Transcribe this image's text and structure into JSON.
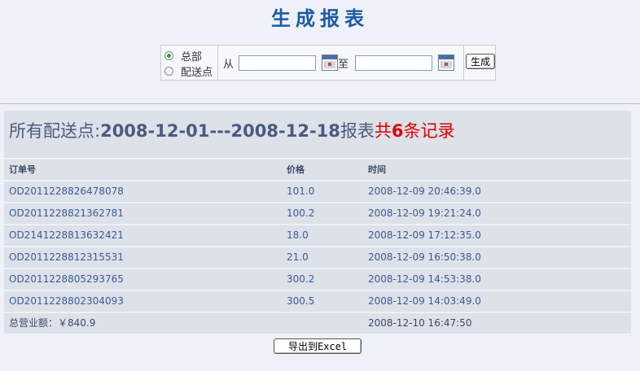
{
  "page": {
    "title": "生成报表"
  },
  "form": {
    "scope_options": [
      {
        "label": "总部",
        "selected": true
      },
      {
        "label": "配送点",
        "selected": false
      }
    ],
    "from_label": "从",
    "to_label": "至",
    "from_value": "",
    "to_value": "",
    "generate_label": "生成"
  },
  "report": {
    "heading_prefix": "所有配送点:",
    "heading_range": "2008-12-01---2008-12-18",
    "heading_suffix": "报表",
    "heading_count_prefix": "共",
    "heading_count": "6",
    "heading_count_suffix": "条记录",
    "columns": [
      "订单号",
      "价格",
      "时间"
    ],
    "rows": [
      {
        "order": "OD2011228826478078",
        "price": "101.0",
        "time": "2008-12-09 20:46:39.0"
      },
      {
        "order": "OD2011228821362781",
        "price": "100.2",
        "time": "2008-12-09 19:21:24.0"
      },
      {
        "order": "OD2141228813632421",
        "price": "18.0",
        "time": "2008-12-09 17:12:35.0"
      },
      {
        "order": "OD2011228812315531",
        "price": "21.0",
        "time": "2008-12-09 16:50:38.0"
      },
      {
        "order": "OD2011228805293765",
        "price": "300.2",
        "time": "2008-12-09 14:53:38.0"
      },
      {
        "order": "OD2011228802304093",
        "price": "300.5",
        "time": "2008-12-09 14:03:49.0"
      }
    ],
    "summary_label": "总营业额：￥840.9",
    "summary_time": "2008-12-10 16:47:50"
  },
  "export_label": "导出到Excel",
  "colors": {
    "title": "#1e5aa8",
    "accent_red": "#e00000",
    "link_blue": "#3c5a9a",
    "row_bg": "#dde1e8",
    "page_bg": "#eef2f8"
  }
}
